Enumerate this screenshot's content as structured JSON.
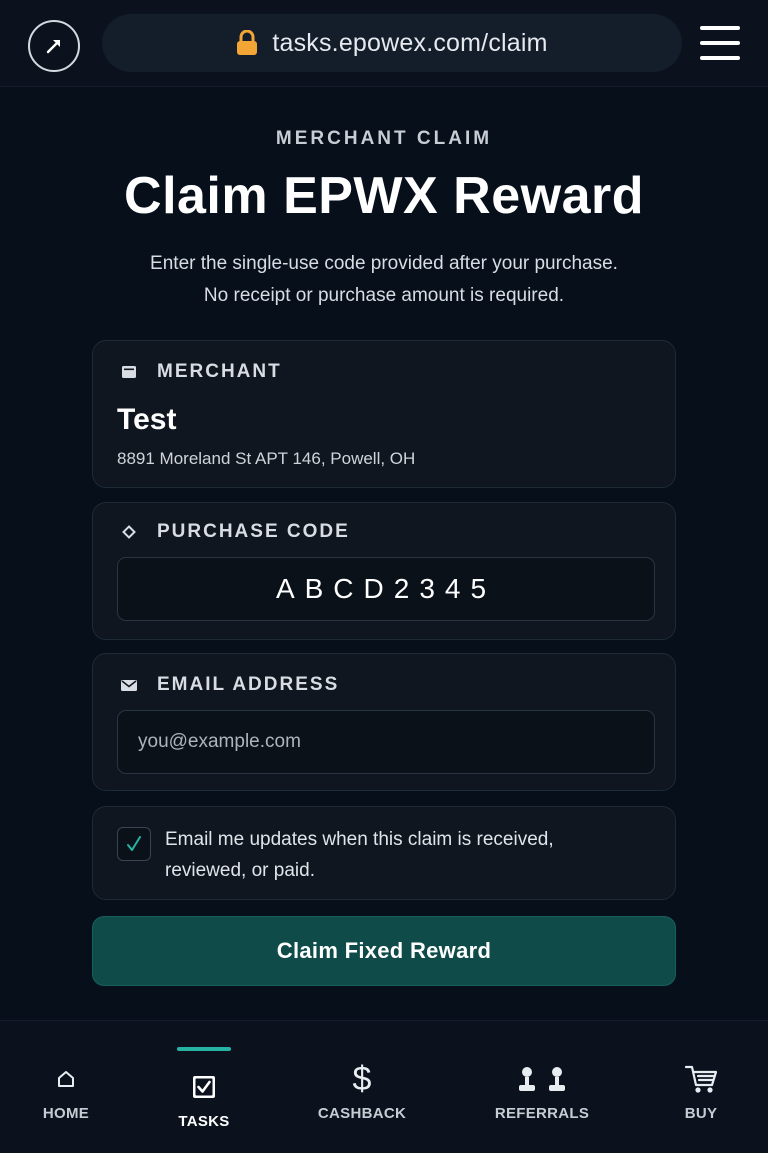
{
  "browser": {
    "url": "tasks.epowex.com/claim",
    "icons": {
      "extension": "arrow-diagonal-icon",
      "lock": "lock-icon",
      "menu": "hamburger-menu-icon"
    },
    "lock_color": "#f3a536"
  },
  "header": {
    "eyebrow": "MERCHANT CLAIM",
    "title": "Claim EPWX Reward",
    "subtitle_line1": "Enter the single-use code provided after your purchase.",
    "subtitle_line2": "No receipt or purchase amount is required."
  },
  "merchant": {
    "label": "MERCHANT",
    "icon": "store-icon",
    "name": "Test",
    "address": "8891 Moreland St APT 146, Powell, OH"
  },
  "purchase_code": {
    "label": "PURCHASE CODE",
    "icon": "diamond-icon",
    "value": "ABCD2345"
  },
  "email": {
    "label": "EMAIL ADDRESS",
    "icon": "envelope-icon",
    "value": "",
    "placeholder": "you@example.com"
  },
  "updates": {
    "checked": true,
    "text": "Email me updates when this claim is received, reviewed, or paid.",
    "check_color": "#27b3a3"
  },
  "submit": {
    "label": "Claim Fixed Reward",
    "color": "#0f4c49"
  },
  "nav": {
    "active": "tasks",
    "accent": "#27b3a3",
    "items": [
      {
        "id": "home",
        "label": "HOME",
        "icon": "home-icon"
      },
      {
        "id": "tasks",
        "label": "TASKS",
        "icon": "checkbox-icon"
      },
      {
        "id": "cashback",
        "label": "CASHBACK",
        "icon": "dollar-icon"
      },
      {
        "id": "referrals",
        "label": "REFERRALS",
        "icon": "people-icon"
      },
      {
        "id": "buy",
        "label": "BUY",
        "icon": "cart-icon"
      }
    ]
  }
}
